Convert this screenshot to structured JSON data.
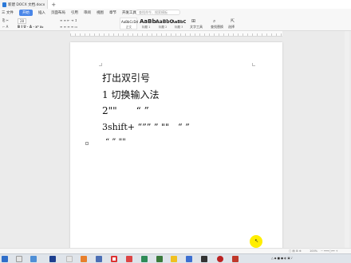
{
  "window": {
    "tab_title": "新建 DOCX 文档.docx"
  },
  "menu": {
    "items": [
      "三 文件",
      "开始",
      "插入",
      "页面布局",
      "引用",
      "审阅",
      "视图",
      "章节",
      "开发工具",
      "会员专享"
    ],
    "search_placeholder": "查找命令、搜索模板"
  },
  "ribbon": {
    "font_size": "28",
    "styles": [
      {
        "sample": "AaBbCcDd",
        "name": "正文"
      },
      {
        "sample": "AaBb",
        "name": "标题 1"
      },
      {
        "sample": "AaBbC",
        "name": "标题 2"
      },
      {
        "sample": "AaBbC",
        "name": "标题 3"
      }
    ],
    "text_tools_label": "文字工具",
    "find_replace_label": "查找替换",
    "select_label": "选择"
  },
  "document": {
    "lines": [
      "打出双引号",
      "1 切换输入法",
      "2\"\"  “ ”",
      "3shift+ “”” ” \"\" “ ”",
      "“ ” \"\""
    ]
  },
  "statusbar": {
    "zoom": "100%"
  },
  "colors": {
    "accent": "#4a86e8",
    "doc_icon": "#2b79d8",
    "cursor_highlight": "#ffee00"
  }
}
